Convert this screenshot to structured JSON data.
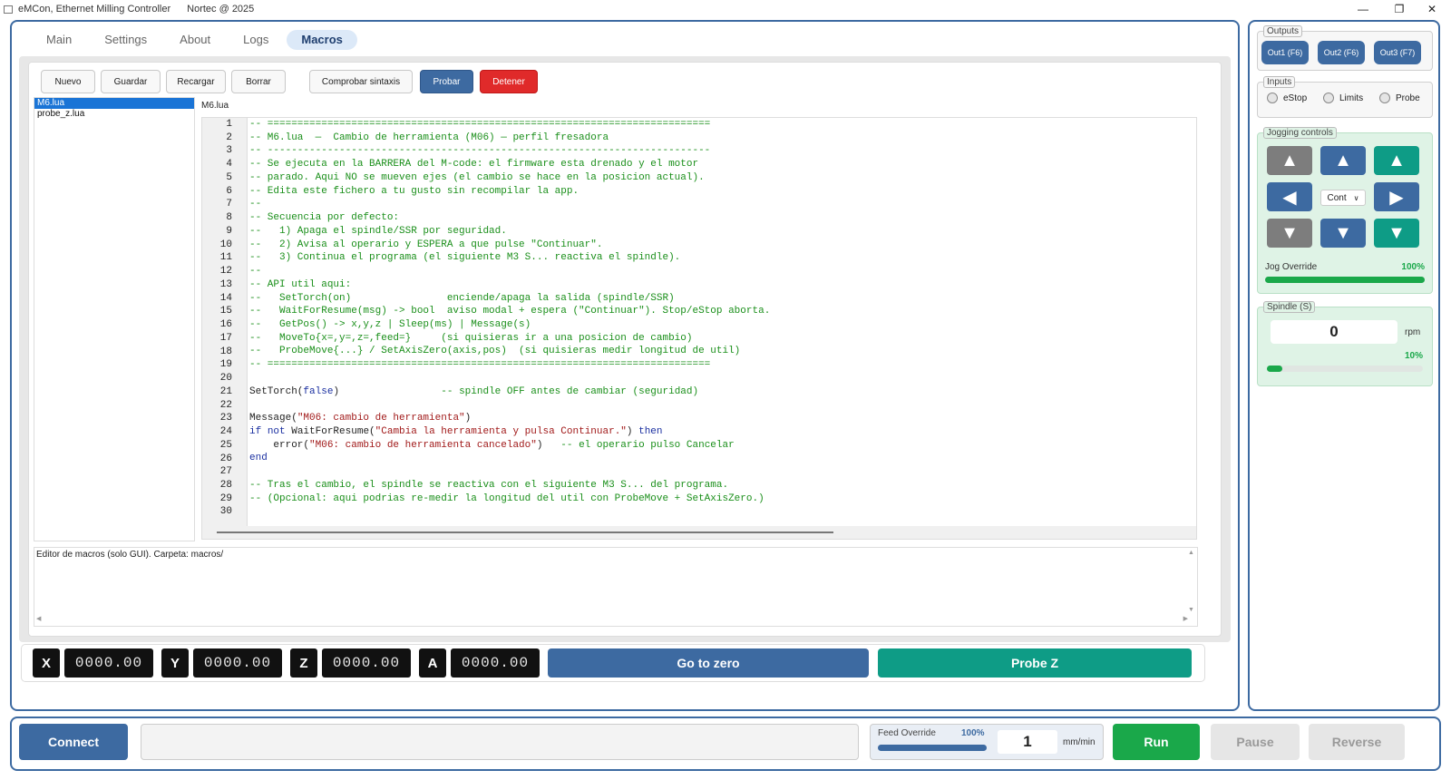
{
  "titlebar": {
    "app": "eMCon, Ethernet Milling Controller",
    "company": "Nortec @ 2025"
  },
  "tabs": [
    "Main",
    "Settings",
    "About",
    "Logs",
    "Macros"
  ],
  "toolbar": {
    "new": "Nuevo",
    "save": "Guardar",
    "reload": "Recargar",
    "delete": "Borrar",
    "check": "Comprobar sintaxis",
    "test": "Probar",
    "stop": "Detener"
  },
  "files": [
    "M6.lua",
    "probe_z.lua"
  ],
  "current_file": "M6.lua",
  "code_lines": [
    "-- ==========================================================================",
    "-- M6.lua  —  Cambio de herramienta (M06) — perfil fresadora",
    "-- --------------------------------------------------------------------------",
    "-- Se ejecuta en la BARRERA del M-code: el firmware esta drenado y el motor",
    "-- parado. Aqui NO se mueven ejes (el cambio se hace en la posicion actual).",
    "-- Edita este fichero a tu gusto sin recompilar la app.",
    "--",
    "-- Secuencia por defecto:",
    "--   1) Apaga el spindle/SSR por seguridad.",
    "--   2) Avisa al operario y ESPERA a que pulse \"Continuar\".",
    "--   3) Continua el programa (el siguiente M3 S... reactiva el spindle).",
    "--",
    "-- API util aqui:",
    "--   SetTorch(on)                enciende/apaga la salida (spindle/SSR)",
    "--   WaitForResume(msg) -> bool  aviso modal + espera (\"Continuar\"). Stop/eStop aborta.",
    "--   GetPos() -> x,y,z | Sleep(ms) | Message(s)",
    "--   MoveTo{x=,y=,z=,feed=}     (si quisieras ir a una posicion de cambio)",
    "--   ProbeMove{...} / SetAxisZero(axis,pos)  (si quisieras medir longitud de util)",
    "-- ==========================================================================",
    "",
    "SetTorch(false)                 -- spindle OFF antes de cambiar (seguridad)",
    "",
    "Message(\"M06: cambio de herramienta\")",
    "if not WaitForResume(\"Cambia la herramienta y pulsa Continuar.\") then",
    "    error(\"M06: cambio de herramienta cancelado\")   -- el operario pulso Cancelar",
    "end",
    "",
    "-- Tras el cambio, el spindle se reactiva con el siguiente M3 S... del programa.",
    "-- (Opcional: aqui podrias re-medir la longitud del util con ProbeMove + SetAxisZero.)",
    ""
  ],
  "console_text": "Editor de macros (solo GUI). Carpeta: macros/",
  "dro": {
    "x_label": "X",
    "x": "0000.00",
    "y_label": "Y",
    "y": "0000.00",
    "z_label": "Z",
    "z": "0000.00",
    "a_label": "A",
    "a": "0000.00",
    "go_zero": "Go to zero",
    "probe_z": "Probe Z"
  },
  "outputs": {
    "title": "Outputs",
    "items": [
      "Out1 (F6)",
      "Out2 (F6)",
      "Out3 (F7)"
    ]
  },
  "inputs": {
    "title": "Inputs",
    "items": [
      "eStop",
      "Limits",
      "Probe"
    ]
  },
  "jogging": {
    "title": "Jogging controls",
    "mode": "Cont",
    "override_label": "Jog Override",
    "override_value": "100%",
    "override_fraction": 1.0
  },
  "spindle": {
    "title": "Spindle (S)",
    "value": "0",
    "unit": "rpm",
    "percent": "10%",
    "fraction": 0.1
  },
  "bottom": {
    "connect": "Connect",
    "status": "",
    "feed_label": "Feed Override",
    "feed_value": "100%",
    "feed_fraction": 1.0,
    "feed_input": "1",
    "feed_unit": "mm/min",
    "run": "Run",
    "pause": "Pause",
    "reverse": "Reverse"
  },
  "colors": {
    "accent": "#3d6aa1",
    "run": "#1aa84a",
    "stop": "#e02a2a",
    "teal": "#0e9c86"
  }
}
